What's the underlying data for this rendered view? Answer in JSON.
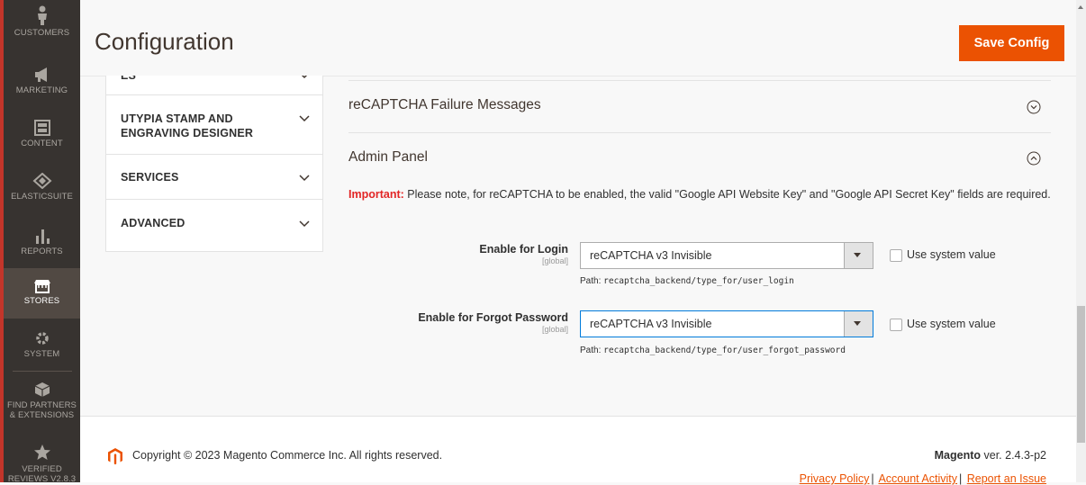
{
  "sidebar": {
    "items": [
      {
        "label": "CUSTOMERS",
        "icon": "customers-icon"
      },
      {
        "label": "MARKETING",
        "icon": "megaphone-icon"
      },
      {
        "label": "CONTENT",
        "icon": "content-icon"
      },
      {
        "label": "ELASTICSUITE",
        "icon": "elasticsuite-icon"
      },
      {
        "label": "REPORTS",
        "icon": "bar-chart-icon"
      },
      {
        "label": "STORES",
        "icon": "store-icon"
      },
      {
        "label": "SYSTEM",
        "icon": "gear-icon"
      },
      {
        "label_line1": "FIND PARTNERS",
        "label_line2": "& EXTENSIONS",
        "icon": "cube-icon"
      },
      {
        "label_line1": "VERIFIED",
        "label_line2": "REVIEWS V2.8.3",
        "icon": "star-icon"
      }
    ],
    "active_item": "STORES",
    "accent_color": "#c2352a"
  },
  "header": {
    "title": "Configuration",
    "save_label": "Save Config"
  },
  "tabs": {
    "partial_label": "ES",
    "items": [
      {
        "label_line1": "UTYPIA STAMP AND",
        "label_line2": "ENGRAVING DESIGNER"
      },
      {
        "label": "SERVICES"
      },
      {
        "label": "ADVANCED"
      }
    ]
  },
  "content": {
    "sections": [
      {
        "title": "reCAPTCHA Failure Messages",
        "state": "collapsed"
      },
      {
        "title": "Admin Panel",
        "state": "expanded"
      }
    ],
    "note_strong": "Important:",
    "note_text": " Please note, for reCAPTCHA to be enabled, the valid \"Google API Website Key\" and \"Google API Secret Key\" fields are required.",
    "fields": [
      {
        "label": "Enable for Login",
        "scope": "[global]",
        "value": "reCAPTCHA v3 Invisible",
        "use_system_value": "Use system value",
        "path_prefix": "Path: ",
        "path": "recaptcha_backend/type_for/user_login"
      },
      {
        "label": "Enable for Forgot Password",
        "scope": "[global]",
        "value": "reCAPTCHA v3 Invisible",
        "use_system_value": "Use system value",
        "path_prefix": "Path: ",
        "path": "recaptcha_backend/type_for/user_forgot_password"
      }
    ]
  },
  "footer": {
    "copyright": "Copyright © 2023 Magento Commerce Inc. All rights reserved.",
    "brand": "Magento",
    "version": " ver. 2.4.3-p2",
    "links": [
      "Privacy Policy",
      "Account Activity",
      "Report an Issue"
    ],
    "link_color": "#eb5202"
  },
  "colors": {
    "primary_button": "#eb5202",
    "important_text": "#e22626",
    "sidebar_bg": "#373330"
  }
}
